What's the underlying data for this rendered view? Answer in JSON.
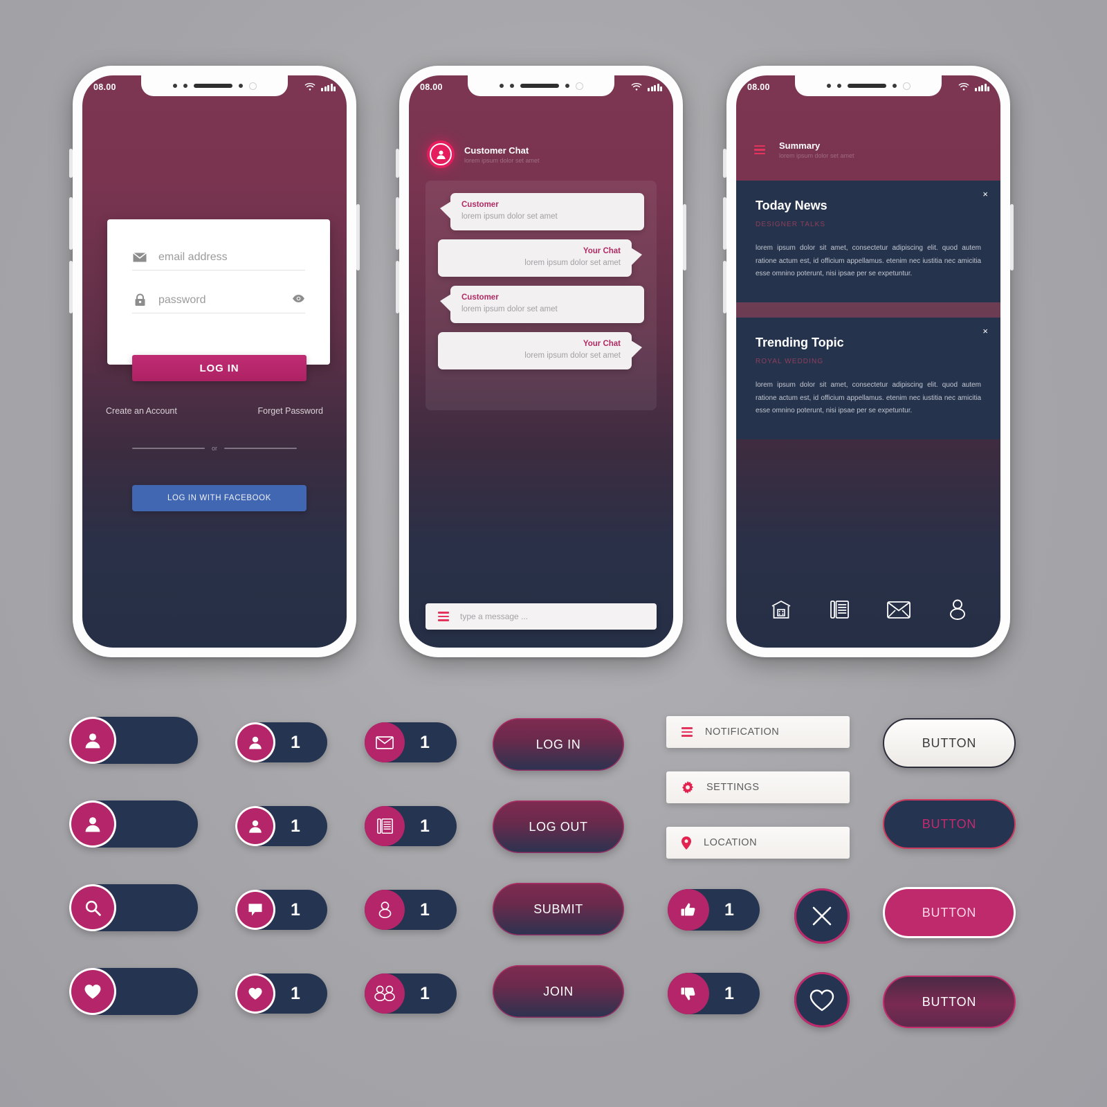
{
  "theme": {
    "navy": "#253450",
    "pink": "#bf2a6d",
    "crimson": "#e2345c",
    "facebook_blue": "#4267b2",
    "page_background": "#a9a9ad"
  },
  "statusbar": {
    "time": "08.00",
    "wifi_icon": "wifi-icon",
    "battery_icon": "battery-icon"
  },
  "phone_login": {
    "email": {
      "icon": "envelope-icon",
      "placeholder": "email address",
      "value": ""
    },
    "password": {
      "icon": "lock-icon",
      "placeholder": "password",
      "value": "",
      "reveal_icon": "eye-icon"
    },
    "login_button": "LOG IN",
    "create_account_link": "Create an Account",
    "forget_password_link": "Forget Password",
    "divider_label": "or",
    "facebook_button": "LOG IN WITH FACEBOOK"
  },
  "phone_chat": {
    "avatar_icon": "user-avatar-icon",
    "title": "Customer Chat",
    "subtitle": "lorem ipsum dolor set amet",
    "messages": [
      {
        "side": "left",
        "who": "Customer",
        "text": "lorem ipsum dolor set amet"
      },
      {
        "side": "right",
        "who": "Your Chat",
        "text": "lorem ipsum dolor set amet"
      },
      {
        "side": "left",
        "who": "Customer",
        "text": "lorem ipsum dolor set amet"
      },
      {
        "side": "right",
        "who": "Your Chat",
        "text": "lorem ipsum dolor set amet"
      }
    ],
    "input": {
      "menu_icon": "hamburger-icon",
      "placeholder": "type a message ...",
      "value": ""
    }
  },
  "phone_summary": {
    "menu_icon": "hamburger-icon",
    "title": "Summary",
    "subtitle": "lorem ipsum dolor set amet",
    "cards": [
      {
        "title": "Today News",
        "tag": "DESIGNER TALKS",
        "body": "lorem ipsum dolor sit amet, consectetur adipiscing elit. quod autem ratione actum est, id officium appellamus. etenim nec iustitia nec amicitia esse omnino poterunt, nisi ipsae per se expetuntur.",
        "close_label": "×"
      },
      {
        "title": "Trending Topic",
        "tag": "ROYAL WEDDING",
        "body": "lorem ipsum dolor sit amet, consectetur adipiscing elit. quod autem ratione actum est, id officium appellamus. etenim nec iustitia nec amicitia esse omnino poterunt, nisi ipsae per se expetuntur.",
        "close_label": "×"
      }
    ],
    "bottom_nav": [
      {
        "icon": "store-home-icon",
        "label": "Home"
      },
      {
        "icon": "news-list-icon",
        "label": "News"
      },
      {
        "icon": "envelope-icon",
        "label": "Messages"
      },
      {
        "icon": "person-icon",
        "label": "Profile"
      }
    ]
  },
  "kit": {
    "icon_pills": [
      {
        "icon": "person-icon",
        "ringed": true,
        "count": ""
      },
      {
        "icon": "person-icon",
        "ringed": true,
        "count": "1"
      },
      {
        "icon": "envelope-icon",
        "ringed": false,
        "count": "1"
      },
      {
        "icon": "person-icon",
        "ringed": true,
        "count": ""
      },
      {
        "icon": "person-icon",
        "ringed": true,
        "count": "1"
      },
      {
        "icon": "news-list-icon",
        "ringed": false,
        "count": "1"
      },
      {
        "icon": "search-icon",
        "ringed": true,
        "count": ""
      },
      {
        "icon": "chat-bubble-icon",
        "ringed": true,
        "count": "1"
      },
      {
        "icon": "single-user-icon",
        "ringed": false,
        "count": "1"
      },
      {
        "icon": "heart-icon",
        "ringed": true,
        "count": ""
      },
      {
        "icon": "heart-icon",
        "ringed": true,
        "count": "1"
      },
      {
        "icon": "two-users-icon",
        "ringed": false,
        "count": "1"
      }
    ],
    "action_buttons": [
      "LOG IN",
      "LOG OUT",
      "SUBMIT",
      "JOIN"
    ],
    "list_items": [
      {
        "icon": "hamburger-icon",
        "label": "NOTIFICATION"
      },
      {
        "icon": "gear-icon",
        "label": "SETTINGS"
      },
      {
        "icon": "pin-icon",
        "label": "LOCATION"
      }
    ],
    "vote_pills": [
      {
        "icon": "thumbs-up-icon",
        "count": "1"
      },
      {
        "icon": "thumbs-down-icon",
        "count": "1"
      }
    ],
    "round_buttons": [
      {
        "icon": "close-x-icon"
      },
      {
        "icon": "heart-outline-icon"
      }
    ],
    "plain_buttons": [
      {
        "label": "BUTTON",
        "style": "light"
      },
      {
        "label": "BUTTON",
        "style": "navy"
      },
      {
        "label": "BUTTON",
        "style": "pink"
      },
      {
        "label": "BUTTON",
        "style": "grad"
      }
    ]
  }
}
